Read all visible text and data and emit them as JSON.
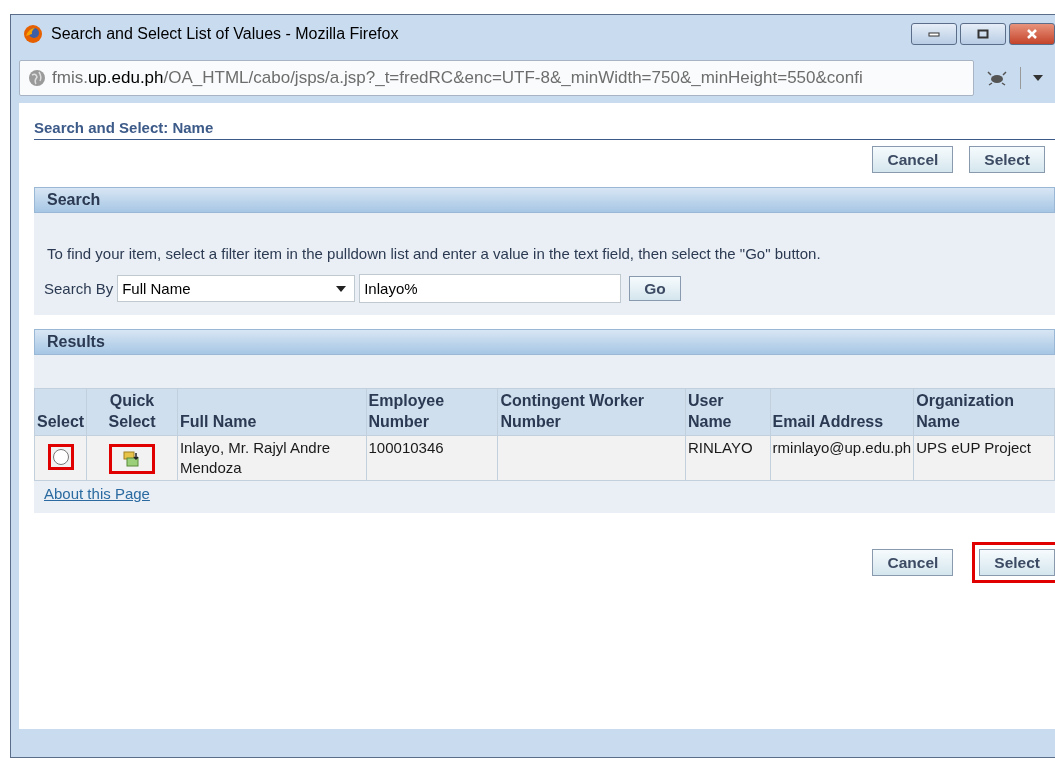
{
  "window": {
    "title": "Search and Select List of Values - Mozilla Firefox",
    "url_domain_prefix": "fmis.",
    "url_domain": "up.edu.ph",
    "url_path": "/OA_HTML/cabo/jsps/a.jsp?_t=fredRC&enc=UTF-8&_minWidth=750&_minHeight=550&confi"
  },
  "page_title": "Search and Select: Name",
  "top_buttons": [
    {
      "label": "Cancel",
      "highlighted": false
    },
    {
      "label": "Select",
      "highlighted": false
    }
  ],
  "search": {
    "heading": "Search",
    "instructions": "To find your item, select a filter item in the pulldown list and enter a value in the text field, then select the \"Go\" button.",
    "search_by_label": "Search By",
    "filter": "Full Name",
    "value": "Inlayo%",
    "go_label": "Go"
  },
  "results": {
    "heading": "Results",
    "columns": [
      "Select",
      "Quick Select",
      "Full Name",
      "Employee Number",
      "Contingent Worker Number",
      "User Name",
      "Email Address",
      "Organization Name"
    ],
    "rows": [
      {
        "selected": false,
        "select_highlighted": true,
        "quick_highlighted": true,
        "full_name": "Inlayo, Mr. Rajyl Andre Mendoza",
        "employee_number": "100010346",
        "contingent_worker_number": "",
        "user_name": "RINLAYO",
        "email": "rminlayo@up.edu.ph",
        "organization": "UPS eUP Project"
      }
    ]
  },
  "about_link": "About this Page",
  "bottom_buttons": [
    {
      "label": "Cancel",
      "highlighted": false
    },
    {
      "label": "Select",
      "highlighted": true
    }
  ]
}
